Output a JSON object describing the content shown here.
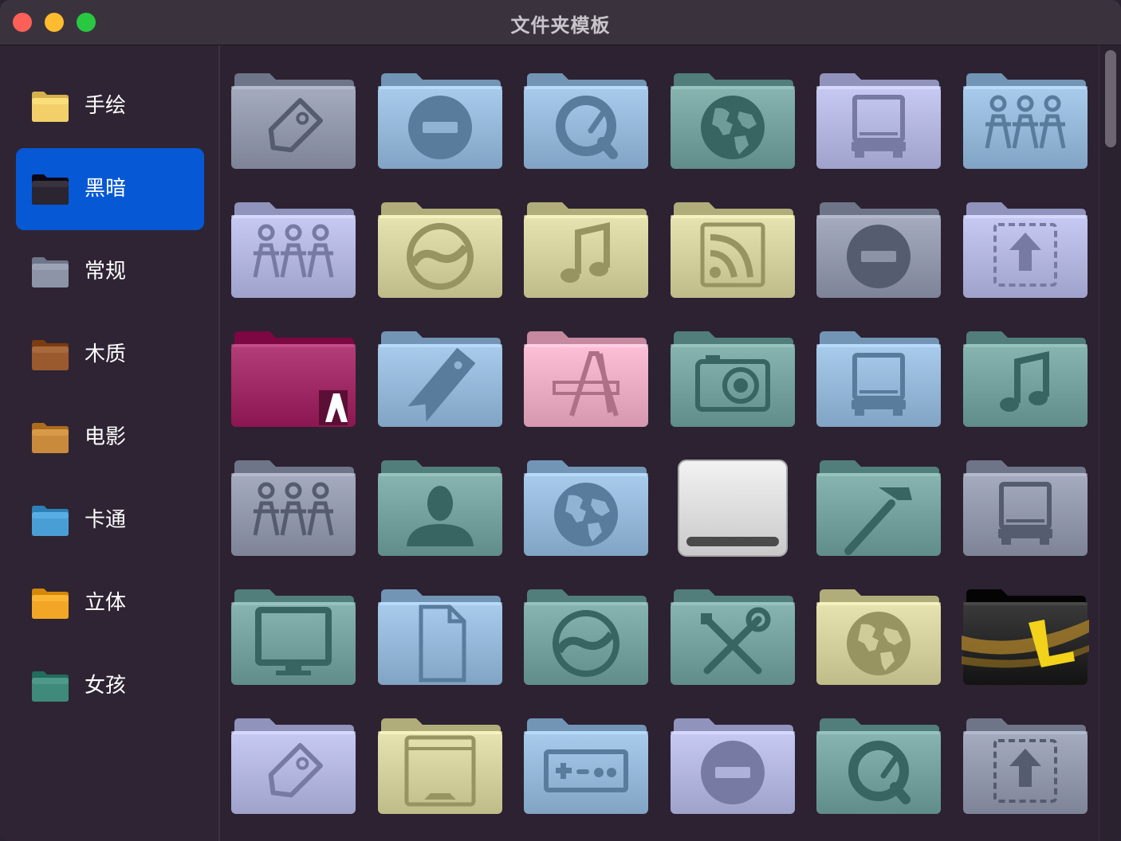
{
  "window": {
    "title": "文件夹模板"
  },
  "sidebar": {
    "items": [
      {
        "label": "手绘",
        "icon": "hand-drawn-folder-icon",
        "selected": false,
        "color": "#f3cf6a"
      },
      {
        "label": "黑暗",
        "icon": "dark-folder-icon",
        "selected": true,
        "color": "#2a2530"
      },
      {
        "label": "常规",
        "icon": "regular-folder-icon",
        "selected": false,
        "color": "#8d94a8"
      },
      {
        "label": "木质",
        "icon": "wood-folder-icon",
        "selected": false,
        "color": "#9a5a2d"
      },
      {
        "label": "电影",
        "icon": "movie-folder-icon",
        "selected": false,
        "color": "#c98a3b"
      },
      {
        "label": "卡通",
        "icon": "cartoon-folder-icon",
        "selected": false,
        "color": "#4a9ed6"
      },
      {
        "label": "立体",
        "icon": "3d-folder-icon",
        "selected": false,
        "color": "#f3a626"
      },
      {
        "label": "女孩",
        "icon": "girl-folder-icon",
        "selected": false,
        "color": "#3f8a7a"
      }
    ]
  },
  "colors": {
    "slate": "#8d93a6",
    "blue": "#90b3d4",
    "teal": "#6f9c98",
    "lavender": "#aeb1da",
    "khaki": "#cfcb98",
    "pink": "#e4a7bd",
    "adobe": "#9b2560",
    "black": "#222222",
    "white": "#e8e8e8",
    "selected_bg": "#0658d5"
  },
  "grid": [
    {
      "icon": "tag-icon",
      "color": "slate"
    },
    {
      "icon": "minus-circle-icon",
      "color": "blue"
    },
    {
      "icon": "quicktime-icon",
      "color": "blue"
    },
    {
      "icon": "globe-icon",
      "color": "teal"
    },
    {
      "icon": "truck-icon",
      "color": "lavender"
    },
    {
      "icon": "people-icon",
      "color": "blue"
    },
    {
      "icon": "people-icon",
      "color": "lavender"
    },
    {
      "icon": "swirl-icon",
      "color": "khaki"
    },
    {
      "icon": "music-note-icon",
      "color": "khaki"
    },
    {
      "icon": "rss-icon",
      "color": "khaki"
    },
    {
      "icon": "minus-circle-icon",
      "color": "slate"
    },
    {
      "icon": "upload-icon",
      "color": "lavender"
    },
    {
      "icon": "adobe-icon",
      "color": "adobe"
    },
    {
      "icon": "bookmark-icon",
      "color": "blue"
    },
    {
      "icon": "app-store-icon",
      "color": "pink"
    },
    {
      "icon": "camera-icon",
      "color": "teal"
    },
    {
      "icon": "truck-icon",
      "color": "blue"
    },
    {
      "icon": "music-note-icon",
      "color": "teal"
    },
    {
      "icon": "people-icon",
      "color": "slate"
    },
    {
      "icon": "user-icon",
      "color": "teal"
    },
    {
      "icon": "globe-icon",
      "color": "blue"
    },
    {
      "icon": "external-drive-icon",
      "color": "white"
    },
    {
      "icon": "hammer-icon",
      "color": "teal"
    },
    {
      "icon": "truck-icon",
      "color": "slate"
    },
    {
      "icon": "monitor-icon",
      "color": "teal"
    },
    {
      "icon": "document-icon",
      "color": "blue"
    },
    {
      "icon": "swirl-icon",
      "color": "teal"
    },
    {
      "icon": "tools-icon",
      "color": "teal"
    },
    {
      "icon": "globe-icon",
      "color": "khaki"
    },
    {
      "icon": "office-icon",
      "color": "black"
    },
    {
      "icon": "tag-icon",
      "color": "lavender"
    },
    {
      "icon": "window-icon",
      "color": "khaki"
    },
    {
      "icon": "gamepad-icon",
      "color": "blue"
    },
    {
      "icon": "minus-circle-icon",
      "color": "lavender"
    },
    {
      "icon": "quicktime-icon",
      "color": "teal"
    },
    {
      "icon": "upload-icon",
      "color": "slate"
    }
  ]
}
